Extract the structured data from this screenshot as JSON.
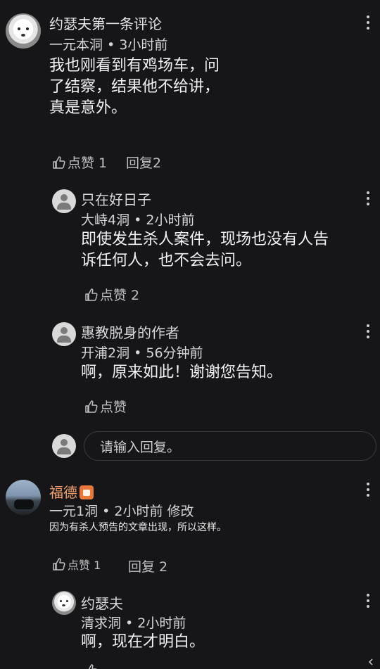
{
  "comments": [
    {
      "name": "约瑟夫第一条评论",
      "meta": "一元本洞 • 3小时前",
      "text_lines": [
        "我也刚看到有鸡场车，问",
        "了结察，结果他不给讲，",
        "真是意外。"
      ],
      "like_label": "点赞 1",
      "reply_label": "回复2",
      "replies": [
        {
          "name": "只在好日子",
          "meta": "大峙4洞 • 2小时前",
          "text_lines": [
            "即使发生杀人案件，现场也没有人告",
            "诉任何人，也不会去问。"
          ],
          "like_label": "点赞 2"
        },
        {
          "name": "惠教脱身的作者",
          "meta": "开浦2洞 • 56分钟前",
          "text_lines": [
            "啊，原来如此！谢谢您告知。"
          ],
          "like_label": "点赞"
        }
      ],
      "reply_input_placeholder": "请输入回复。"
    },
    {
      "name": "福德",
      "meta": "一元1洞 • 2小时前 修改",
      "text_lines": [
        "因为有杀人预告的文章出现，所以这样。"
      ],
      "like_label": "点赞 1",
      "reply_label": "回复 2",
      "replies": [
        {
          "name": "约瑟夫",
          "meta": "清求洞 • 2小时前",
          "text_lines": [
            "啊，现在才明白。"
          ]
        }
      ]
    }
  ],
  "icons": {
    "more": "kebab-vertical-icon",
    "like": "thumbs-up-outline-icon",
    "badge": "orange-level-badge-icon",
    "corner": "collapse-arrow-icon"
  },
  "colors": {
    "background": "#161618",
    "text": "#f2f2f2",
    "secondary": "#bfbfbf",
    "badge": "#e8793a"
  }
}
